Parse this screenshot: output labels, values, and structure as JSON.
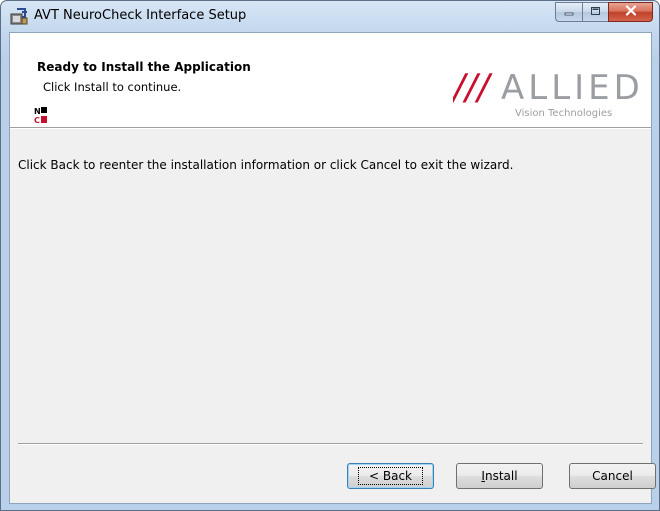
{
  "window": {
    "title": "AVT NeuroCheck Interface Setup",
    "app_icon": "installer-icon",
    "caption_buttons": [
      "minimize-icon",
      "maximize-icon",
      "close-icon"
    ]
  },
  "banner": {
    "title": "Ready to Install the Application",
    "subtitle": "Click Install to continue.",
    "nc_logo": {
      "top": "N",
      "bottom": "C"
    },
    "brand_logo": {
      "slashes": "///",
      "name": "ALLIED",
      "tagline": "Vision Technologies"
    }
  },
  "body": {
    "message": "Click Back to reenter the installation information or click Cancel to exit the wizard."
  },
  "buttons": {
    "back": "< Back",
    "install_prefix": "",
    "install_mnemonic": "I",
    "install_rest": "nstall",
    "cancel": "Cancel"
  },
  "colors": {
    "brand_red": "#c8102e",
    "brand_gray": "#9a9ea3",
    "close_red": "#c0412a"
  }
}
